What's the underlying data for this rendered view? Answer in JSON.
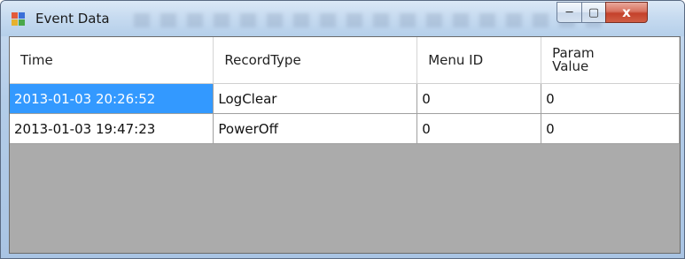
{
  "window": {
    "title": "Event Data",
    "controls": {
      "minimize": "─",
      "maximize": "▢",
      "close": "x"
    }
  },
  "grid": {
    "columns": [
      "Time",
      "RecordType",
      "Menu ID",
      "Param\nValue"
    ],
    "rows": [
      {
        "time": "2013-01-03 20:26:52",
        "record_type": "LogClear",
        "menu_id": "0",
        "param_value": "0"
      },
      {
        "time": "2013-01-03 19:47:23",
        "record_type": "PowerOff",
        "menu_id": "0",
        "param_value": "0"
      }
    ],
    "selected_cell": "rows.0.time"
  },
  "colors": {
    "selection": "#3399ff",
    "empty_area": "#ababab"
  }
}
